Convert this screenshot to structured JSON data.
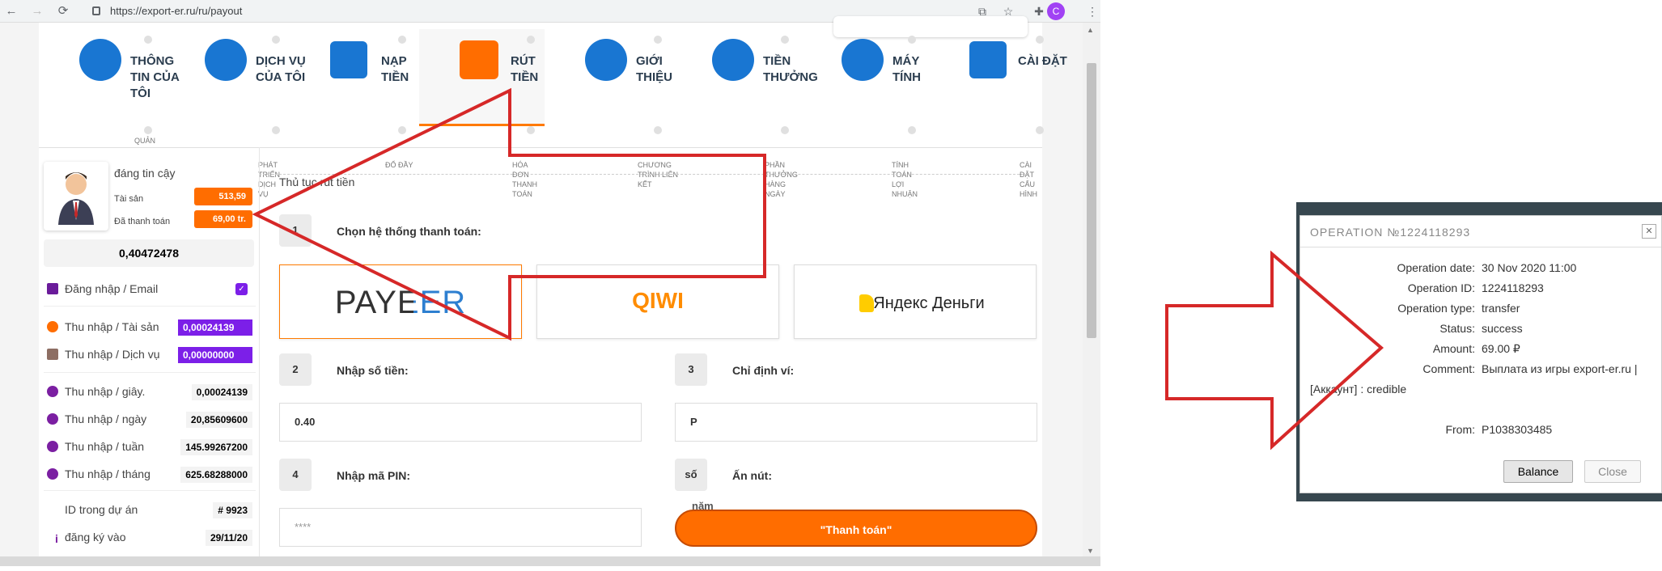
{
  "browser": {
    "url": "https://export-er.ru/ru/payout",
    "profile_initial": "C"
  },
  "nav": {
    "tabs": [
      {
        "label": "THÔNG TIN CỦA TÔI"
      },
      {
        "label": "DỊCH VỤ CỦA TÔI"
      },
      {
        "label": "NẠP TIỀN"
      },
      {
        "label": "RÚT TIỀN"
      },
      {
        "label": "GIỚI THIỆU"
      },
      {
        "label": "TIỀN THƯỞNG"
      },
      {
        "label": "MÁY TÍNH"
      },
      {
        "label": "CÀI ĐẶT"
      }
    ],
    "subtabs": [
      {
        "label": "QUẢN"
      },
      {
        "label": "PHÁT TRIỂN DỊCH VỤ"
      },
      {
        "label": "ĐỔ ĐẦY"
      },
      {
        "label": "HÓA ĐƠN THANH TOÁN"
      },
      {
        "label": "CHƯƠNG TRÌNH LIÊN KẾT"
      },
      {
        "label": "PHẦN THƯỞNG HÀNG NGÀY"
      },
      {
        "label": "TÍNH TOÁN LỢI NHUẬN"
      },
      {
        "label": "CÀI ĐẶT CẤU HÌNH"
      }
    ]
  },
  "sidebar": {
    "title": "đáng tin cậy",
    "assets_label": "Tài sản",
    "assets_value": "513,59",
    "paid_label": "Đã thanh toán",
    "paid_value": "69,00 tr.",
    "balance": "0,40472478",
    "login_label": "Đăng nhập / Email",
    "rows": [
      {
        "label": "Thu nhập / Tài sản",
        "value": "0,00024139"
      },
      {
        "label": "Thu nhập / Dịch vụ",
        "value": "0,00000000"
      },
      {
        "label": "Thu nhập / giây.",
        "value": "0,00024139"
      },
      {
        "label": "Thu nhập / ngày",
        "value": "20,85609600"
      },
      {
        "label": "Thu nhập / tuần",
        "value": "145.99267200"
      },
      {
        "label": "Thu nhập / tháng",
        "value": "625.68288000"
      },
      {
        "label": "ID trong dự án",
        "value": "# 9923"
      },
      {
        "label": "đăng ký vào",
        "value": "29/11/20"
      }
    ]
  },
  "payout": {
    "section_title": "Thủ tục rút tiền",
    "step1": {
      "num": "1",
      "label": "Chọn hệ thống thanh toán:"
    },
    "methods": [
      "PAYEER",
      "QIWI",
      "Яндекс Деньги"
    ],
    "step2": {
      "num": "2",
      "label": "Nhập số tiền:",
      "value": "0.40"
    },
    "step3": {
      "num": "3",
      "label": "Chỉ định ví:",
      "value": "P"
    },
    "step4": {
      "num": "4",
      "label": "Nhập mã PIN:",
      "placeholder": "****"
    },
    "step5": {
      "num": "số",
      "label": "Ấn nút:",
      "extra": "năm"
    },
    "pay_button": "\"Thanh toán\""
  },
  "dialog": {
    "title": "OPERATION №1224118293",
    "rows": [
      {
        "label": "Operation date:",
        "value": "30 Nov 2020 11:00"
      },
      {
        "label": "Operation ID:",
        "value": "1224118293"
      },
      {
        "label": "Operation type:",
        "value": "transfer"
      },
      {
        "label": "Status:",
        "value": "success"
      },
      {
        "label": "Amount:",
        "value": "69.00 ₽"
      },
      {
        "label": "Comment:",
        "value": "Выплата из игры export-er.ru |"
      },
      {
        "label": "From:",
        "value": "P1038303485"
      }
    ],
    "comment_wrap": "[Аккаунт] : credible",
    "balance_button": "Balance",
    "close_button": "Close"
  },
  "colors": {
    "accent": "#ff6d00",
    "nav_blue": "#1976d2",
    "purple": "#7c1fe8",
    "arrow_red": "#d62828"
  }
}
